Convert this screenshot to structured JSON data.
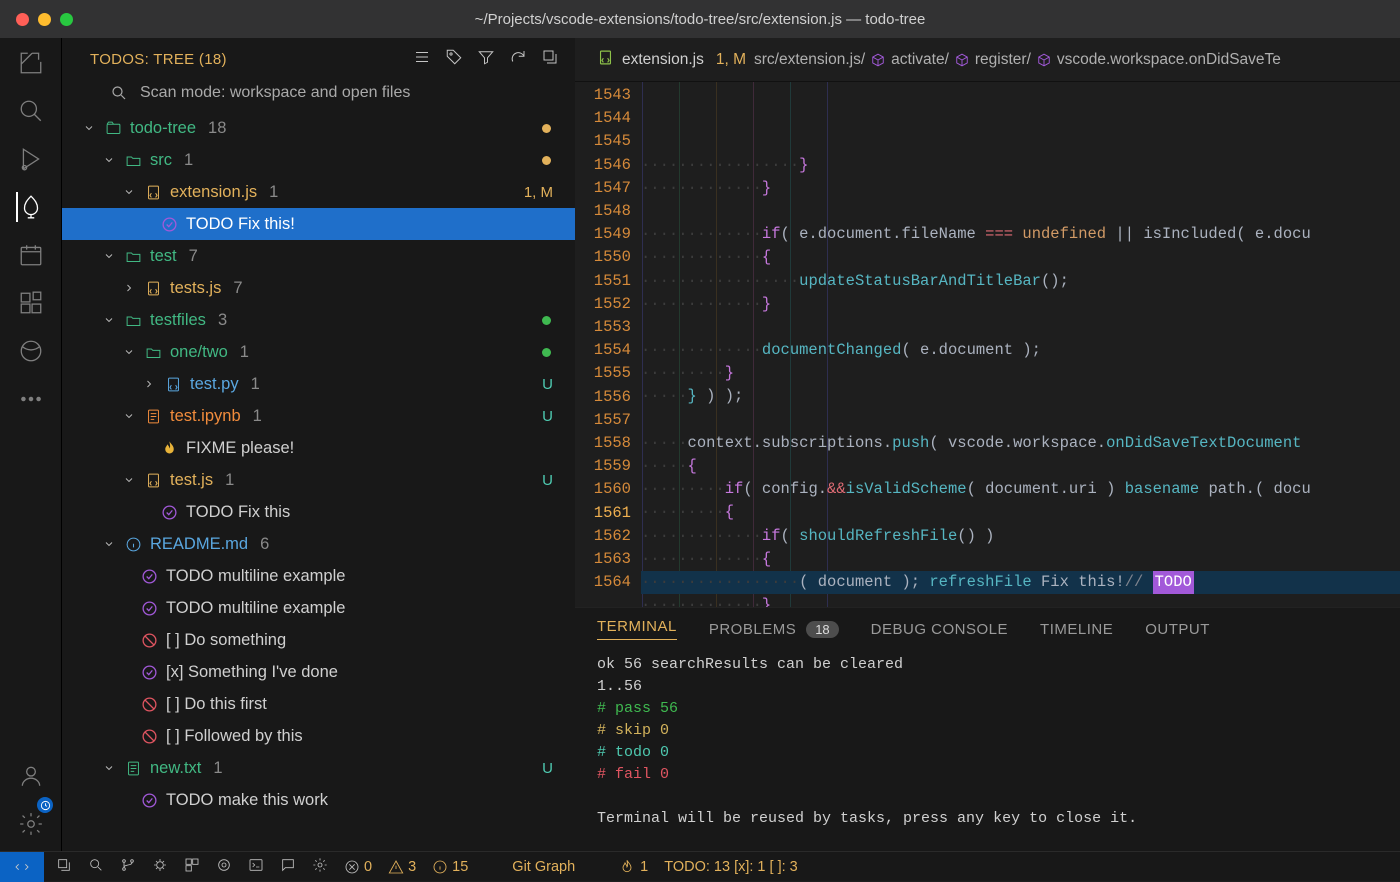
{
  "titlebar": {
    "title": "~/Projects/vscode-extensions/todo-tree/src/extension.js — todo-tree"
  },
  "sidebar": {
    "header": "TODOS: TREE (18)",
    "scan_label": "Scan mode: workspace and open files",
    "tree": {
      "root": {
        "label": "todo-tree",
        "count": "18"
      },
      "src": {
        "label": "src",
        "count": "1"
      },
      "extjs": {
        "label": "extension.js",
        "count": "1",
        "right": "1, M"
      },
      "todo_fix": {
        "label": "TODO Fix this!"
      },
      "test": {
        "label": "test",
        "count": "7"
      },
      "testsjs": {
        "label": "tests.js",
        "count": "7"
      },
      "testfiles": {
        "label": "testfiles",
        "count": "3"
      },
      "onetwo": {
        "label": "one/two",
        "count": "1"
      },
      "testpy": {
        "label": "test.py",
        "count": "1",
        "right": "U"
      },
      "testipynb": {
        "label": "test.ipynb",
        "count": "1",
        "right": "U"
      },
      "fixme": {
        "label": "FIXME please!"
      },
      "testjs2": {
        "label": "test.js",
        "count": "1",
        "right": "U"
      },
      "todo_fix2": {
        "label": "TODO Fix this"
      },
      "readme": {
        "label": "README.md",
        "count": "6"
      },
      "ml1": {
        "label": "TODO multiline example"
      },
      "ml2": {
        "label": "TODO multiline example"
      },
      "do1": {
        "label": "[ ] Do something"
      },
      "done": {
        "label": "[x] Something I've done"
      },
      "do2": {
        "label": "[ ] Do this first"
      },
      "do3": {
        "label": "[ ] Followed by this"
      },
      "newtxt": {
        "label": "new.txt",
        "count": "1",
        "right": "U"
      },
      "makework": {
        "label": "TODO make this work"
      }
    }
  },
  "editor": {
    "tab_file": "extension.js",
    "tab_mod": "1, M",
    "crumb1": "src/extension.js/",
    "crumb2": "activate/",
    "crumb3": "register/",
    "crumb4": "vscode.workspace.onDidSaveTe",
    "line_start": 1543,
    "line_end": 1564,
    "current_line": 1561,
    "lines": {
      "l1543": {
        "ws": "·················",
        "code_brace": "}"
      },
      "l1544": {
        "ws": "·············",
        "code_brace": "}"
      },
      "l1545": {
        "ws": "",
        "code": ""
      },
      "l1546": {
        "ws": "·············",
        "if": "if",
        "p1": "( e.document.fileName ",
        "op": "===",
        "sp": " ",
        "undef": "undefined",
        "p2": " || isIncluded( e.docu"
      },
      "l1547": {
        "ws": "·············",
        "brace": "{"
      },
      "l1548": {
        "ws": "·················",
        "fn": "updateStatusBarAndTitleBar",
        "p": "();"
      },
      "l1549": {
        "ws": "·············",
        "brace": "}"
      },
      "l1550": {
        "ws": "",
        "code": ""
      },
      "l1551": {
        "ws": "·············",
        "fn": "documentChanged",
        "p": "( e.document );"
      },
      "l1552": {
        "ws": "·········",
        "brace": "}"
      },
      "l1553": {
        "ws": "·····",
        "b1": "}",
        "p": " ) );"
      },
      "l1554": {
        "ws": "",
        "code": ""
      },
      "l1555": {
        "ws": "·····",
        "p1": "context.subscriptions.",
        "fn": "push",
        "p2": "( vscode.workspace.",
        "fn2": "onDidSaveTextDocument"
      },
      "l1556": {
        "ws": "·····",
        "brace": "{"
      },
      "l1557": {
        "ws": "·········",
        "if": "if",
        "p1": "( config.",
        "fn": "isValidScheme",
        "p2": "( document.uri ) ",
        "op": "&&",
        "p3": " path.",
        "fn2": "basename",
        "p4": "( docu"
      },
      "l1558": {
        "ws": "·········",
        "brace": "{"
      },
      "l1559": {
        "ws": "·············",
        "if": "if",
        "p1": "( ",
        "fn": "shouldRefreshFile",
        "p2": "() )"
      },
      "l1560": {
        "ws": "·············",
        "brace": "{"
      },
      "l1561": {
        "ws": "·················",
        "fn": "refreshFile",
        "p1": "( document ); ",
        "cm": "// ",
        "todo": "TODO",
        "p2": " Fix this!"
      },
      "l1562": {
        "ws": "·············",
        "brace": "}"
      },
      "l1563": {
        "ws": "·········",
        "brace": "}"
      },
      "l1564": {
        "ws": "·····",
        "b1": "}",
        "p": " ) );"
      }
    }
  },
  "panel": {
    "tabs": {
      "terminal": "TERMINAL",
      "problems": "PROBLEMS",
      "problems_badge": "18",
      "debug": "DEBUG CONSOLE",
      "timeline": "TIMELINE",
      "output": "OUTPUT"
    },
    "t1": "ok 56 searchResults can be cleared",
    "t2": "1..56",
    "t3": "# pass 56",
    "t4": "# skip 0",
    "t5": "# todo 0",
    "t6": "# fail 0",
    "t7": "Terminal will be reused by tasks, press any key to close it."
  },
  "status": {
    "err": "0",
    "warn": "3",
    "info": "15",
    "gitgraph": "Git Graph",
    "fire": "1",
    "todo": "TODO: 13  [x]: 1  [ ]: 3"
  }
}
